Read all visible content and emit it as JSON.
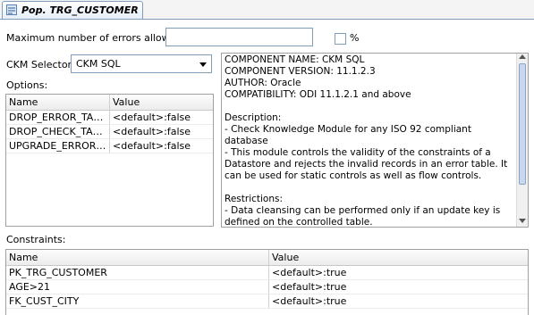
{
  "tab": {
    "label": "Pop. TRG_CUSTOMER"
  },
  "form": {
    "max_errors_label": "Maximum number of errors allowed:",
    "max_errors_value": "",
    "percent_label": "%",
    "ckm_selector_label": "CKM Selector:",
    "ckm_selected": "CKM SQL",
    "options_label": "Options:"
  },
  "options_table": {
    "headers": [
      "Name",
      "Value"
    ],
    "rows": [
      {
        "name": "DROP_ERROR_TABLE",
        "value": "<default>:false"
      },
      {
        "name": "DROP_CHECK_TABLE",
        "value": "<default>:false"
      },
      {
        "name": "UPGRADE_ERROR_T...",
        "value": "<default>:false"
      }
    ]
  },
  "description": {
    "text": "COMPONENT NAME: CKM SQL\nCOMPONENT VERSION: 11.1.2.3\nAUTHOR: Oracle\nCOMPATIBILITY: ODI 11.1.2.1 and above\n\nDescription:\n- Check Knowledge Module for any ISO 92 compliant database\n- This module controls the validity of the constraints of a Datastore and rejects the invalid records in an error table. It can be used for static controls as well as flow controls.\n\nRestrictions:\n- Data cleansing can be performed only if an update key is defined on the controlled table."
  },
  "constraints": {
    "label": "Constraints:",
    "headers": [
      "Name",
      "Value"
    ],
    "rows": [
      {
        "name": "PK_TRG_CUSTOMER",
        "value": "<default>:true"
      },
      {
        "name": "AGE>21",
        "value": "<default>:true"
      },
      {
        "name": "FK_CUST_CITY",
        "value": "<default>:true"
      }
    ]
  },
  "colors": {
    "border": "#7f9db9",
    "grid_border": "#a0a0a0",
    "tab_gradient_bottom": "#e7eef8"
  }
}
